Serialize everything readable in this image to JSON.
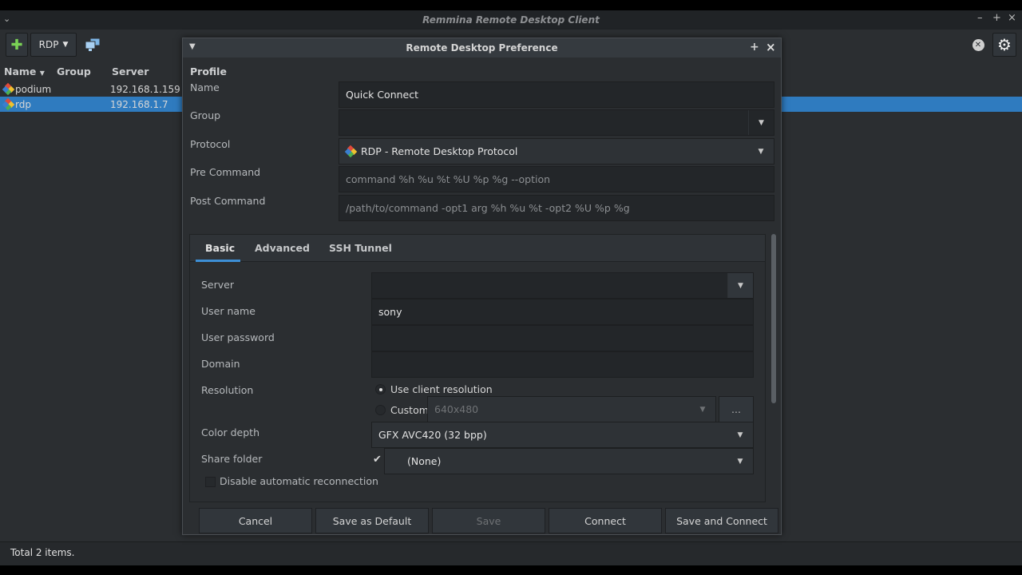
{
  "window": {
    "title": "Remmina Remote Desktop Client"
  },
  "toolbar": {
    "protocol_label": "RDP",
    "new_icon": "plus-icon",
    "screens_icon": "monitors-icon",
    "clear_icon": "clear-icon",
    "settings_icon": "gear-icon"
  },
  "list": {
    "columns": [
      "Name",
      "Group",
      "Server"
    ],
    "rows": [
      {
        "name": "podium",
        "group": "",
        "server": "192.168.1.159",
        "selected": false
      },
      {
        "name": "rdp",
        "group": "",
        "server": "192.168.1.7",
        "selected": true
      }
    ]
  },
  "status": {
    "text": "Total 2 items."
  },
  "dialog": {
    "title": "Remote Desktop Preference",
    "profile_heading": "Profile",
    "name_label": "Name",
    "name_value": "Quick Connect",
    "group_label": "Group",
    "group_value": "",
    "protocol_label": "Protocol",
    "protocol_value": "RDP - Remote Desktop Protocol",
    "pre_command_label": "Pre Command",
    "pre_command_placeholder": "command %h %u %t %U %p %g --option",
    "post_command_label": "Post Command",
    "post_command_placeholder": "/path/to/command -opt1 arg %h %u %t -opt2 %U %p %g",
    "tabs": [
      {
        "label": "Basic",
        "active": true
      },
      {
        "label": "Advanced",
        "active": false
      },
      {
        "label": "SSH Tunnel",
        "active": false
      }
    ],
    "basic": {
      "server_label": "Server",
      "server_value": "",
      "username_label": "User name",
      "username_value": "sony",
      "password_label": "User password",
      "password_value": "",
      "domain_label": "Domain",
      "domain_value": "",
      "resolution_label": "Resolution",
      "use_client_resolution": "Use client resolution",
      "custom_label": "Custom",
      "custom_value": "640x480",
      "custom_more": "...",
      "color_depth_label": "Color depth",
      "color_depth_value": "GFX AVC420 (32 bpp)",
      "share_folder_label": "Share folder",
      "share_folder_value": "(None)",
      "disable_reconnect_label": "Disable automatic reconnection"
    },
    "buttons": {
      "cancel": "Cancel",
      "save_default": "Save as Default",
      "save": "Save",
      "connect": "Connect",
      "save_connect": "Save and Connect"
    }
  },
  "colors": {
    "selection": "#2f7bbf",
    "accent": "#3d8fd6",
    "background": "#2b2e31"
  }
}
